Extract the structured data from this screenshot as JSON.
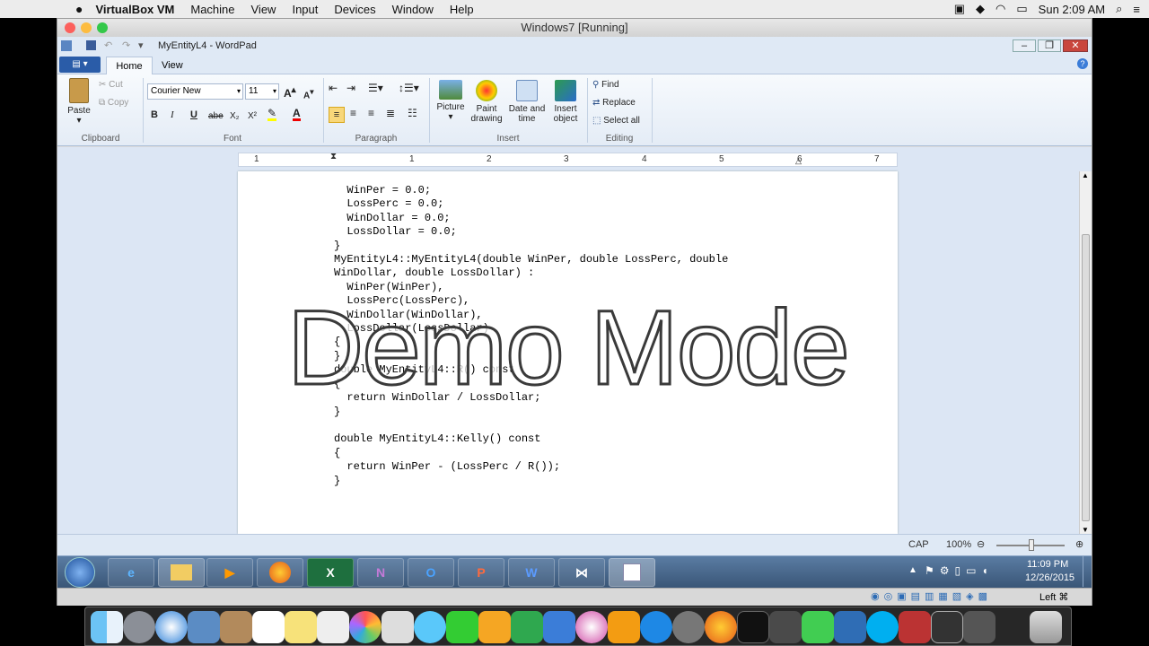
{
  "mac_menu": {
    "app": "VirtualBox VM",
    "items": [
      "Machine",
      "View",
      "Input",
      "Devices",
      "Window",
      "Help"
    ],
    "clock": "Sun 2:09 AM"
  },
  "vm": {
    "title": "Windows7 [Running]"
  },
  "wordpad": {
    "title": "MyEntityL4 - WordPad"
  },
  "ribbon": {
    "tabs": [
      "Home",
      "View"
    ],
    "clipboard": {
      "paste": "Paste",
      "cut": "Cut",
      "copy": "Copy",
      "label": "Clipboard"
    },
    "font": {
      "name": "Courier New",
      "size": "11",
      "label": "Font",
      "bold": "B",
      "italic": "I",
      "underline": "U",
      "strike": "abe",
      "sub": "X₂",
      "sup": "X²"
    },
    "paragraph": {
      "label": "Paragraph"
    },
    "insert": {
      "picture": "Picture",
      "paint": "Paint drawing",
      "datetime": "Date and time",
      "object": "Insert object",
      "label": "Insert"
    },
    "editing": {
      "find": "Find",
      "replace": "Replace",
      "select_all": "Select all",
      "label": "Editing"
    }
  },
  "ruler": [
    "1",
    "1",
    "2",
    "3",
    "4",
    "5",
    "6",
    "7"
  ],
  "document": {
    "lines": [
      "  WinPer = 0.0;",
      "  LossPerc = 0.0;",
      "  WinDollar = 0.0;",
      "  LossDollar = 0.0;",
      "}",
      "MyEntityL4::MyEntityL4(double WinPer, double LossPerc, double",
      "WinDollar, double LossDollar) :",
      "  WinPer(WinPer),",
      "  LossPerc(LossPerc),",
      "  WinDollar(WinDollar),",
      "  LossDollar(LossDollar)",
      "{",
      "}",
      "double MyEntityL4::R() const",
      "{",
      "  return WinDollar / LossDollar;",
      "}",
      "",
      "double MyEntityL4::Kelly() const",
      "{",
      "  return WinPer - (LossPerc / R());",
      "}"
    ]
  },
  "overlay": "Demo Mode",
  "status": {
    "caps": "CAP",
    "zoom": "100%"
  },
  "taskbar": {
    "time": "11:09 PM",
    "date": "12/26/2015"
  },
  "vm_status": {
    "host_key": "Left ⌘"
  }
}
